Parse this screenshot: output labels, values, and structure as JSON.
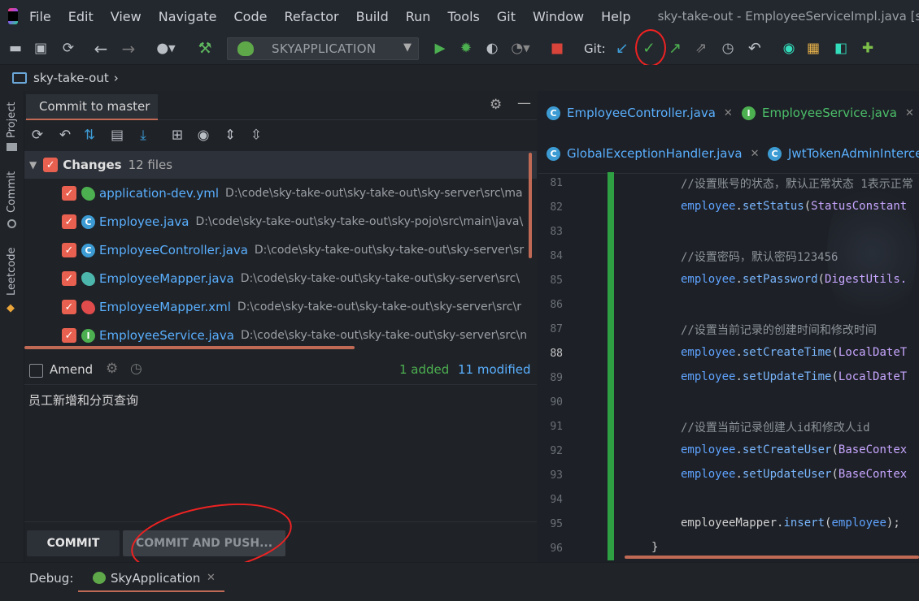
{
  "menu": {
    "items": [
      "File",
      "Edit",
      "View",
      "Navigate",
      "Code",
      "Refactor",
      "Build",
      "Run",
      "Tools",
      "Git",
      "Window",
      "Help"
    ],
    "window_title": "sky-take-out - EmployeeServiceImpl.java [sky-se"
  },
  "toolbar": {
    "run_config": "SKYAPPLICATION",
    "git_label": "Git:"
  },
  "breadcrumb": {
    "project": "sky-take-out"
  },
  "left_strip": {
    "tabs": [
      "Project",
      "Commit",
      "Leetcode"
    ]
  },
  "commit_panel": {
    "tab_title": "Commit to master",
    "changes_label": "Changes",
    "changes_count": "12 files",
    "files": [
      {
        "name": "application-dev.yml",
        "path": "D:\\code\\sky-take-out\\sky-take-out\\sky-server\\src\\ma",
        "icon": "yml-icon",
        "color": "#4caf50"
      },
      {
        "name": "Employee.java",
        "path": "D:\\code\\sky-take-out\\sky-take-out\\sky-pojo\\src\\main\\java\\",
        "icon": "class-icon",
        "color": "#3d9bd4"
      },
      {
        "name": "EmployeeController.java",
        "path": "D:\\code\\sky-take-out\\sky-take-out\\sky-server\\sr",
        "icon": "class-icon",
        "color": "#3d9bd4"
      },
      {
        "name": "EmployeeMapper.java",
        "path": "D:\\code\\sky-take-out\\sky-take-out\\sky-server\\src\\",
        "icon": "mybatis-icon",
        "color": "#4db6ac"
      },
      {
        "name": "EmployeeMapper.xml",
        "path": "D:\\code\\sky-take-out\\sky-take-out\\sky-server\\src\\r",
        "icon": "mybatis-icon",
        "color": "#e04b4b"
      },
      {
        "name": "EmployeeService.java",
        "path": "D:\\code\\sky-take-out\\sky-take-out\\sky-server\\src\\n",
        "icon": "interface-icon",
        "color": "#4caf50"
      }
    ],
    "amend_label": "Amend",
    "added": "1 added",
    "modified": "11 modified",
    "message": "员工新增和分页查询",
    "commit_button": "COMMIT",
    "commit_push_button": "COMMIT AND PUSH..."
  },
  "editor": {
    "tabs_row1": [
      "EmployeeController.java",
      "EmployeeService.java"
    ],
    "tabs_row2": [
      "GlobalExceptionHandler.java",
      "JwtTokenAdminInterce"
    ],
    "line_numbers": [
      "81",
      "82",
      "83",
      "84",
      "85",
      "86",
      "87",
      "88",
      "89",
      "90",
      "91",
      "92",
      "93",
      "94",
      "95",
      "96"
    ],
    "code": {
      "l81": "//设置账号的状态，默认正常状态 1表示正常",
      "l82_obj": "employee",
      "l82_m": "setStatus",
      "l82_arg": "StatusConstant",
      "l84": "//设置密码，默认密码123456",
      "l85_obj": "employee",
      "l85_m": "setPassword",
      "l85_arg": "DigestUtils.",
      "l87": "//设置当前记录的创建时间和修改时间",
      "l88_obj": "employee",
      "l88_m": "setCreateTime",
      "l88_arg": "LocalDateT",
      "l89_obj": "employee",
      "l89_m": "setUpdateTime",
      "l89_arg": "LocalDateT",
      "l91": "//设置当前记录创建人id和修改人id",
      "l92_obj": "employee",
      "l92_m": "setCreateUser",
      "l92_arg": "BaseContex",
      "l93_obj": "employee",
      "l93_m": "setUpdateUser",
      "l93_arg": "BaseContex",
      "l95_obj": "employeeMapper",
      "l95_m": "insert",
      "l95_arg": "employee",
      "l96": "}"
    }
  },
  "debug": {
    "label": "Debug:",
    "tab": "SkyApplication"
  }
}
